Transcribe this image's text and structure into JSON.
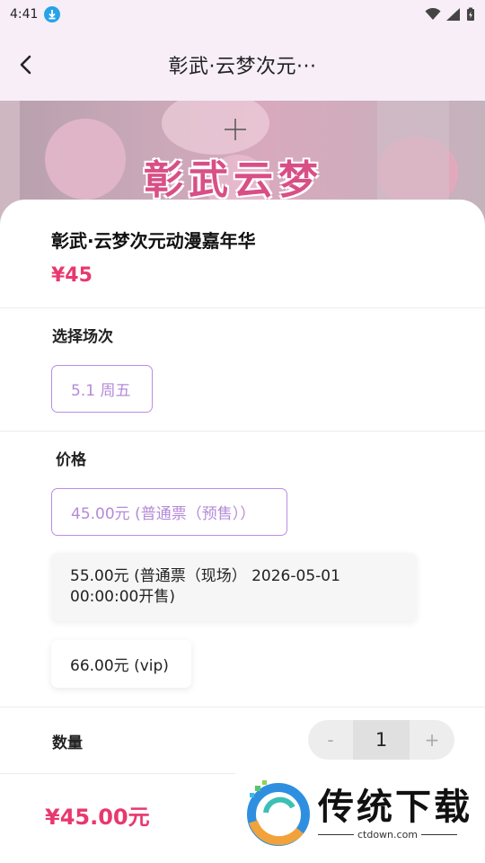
{
  "status": {
    "time": "4:41"
  },
  "header": {
    "title": "彰武·云梦次元···"
  },
  "banner": {
    "title": "彰武云梦"
  },
  "event": {
    "title": "彰武·云梦次元动漫嘉年华",
    "price": "¥45"
  },
  "session": {
    "label": "选择场次",
    "options": [
      "5.1 周五"
    ]
  },
  "pricing": {
    "label": "价格",
    "options": [
      "45.00元 (普通票（预售））",
      "55.00元 (普通票（现场） 2026-05-01",
      "00:00:00开售)",
      "66.00元 (vip)"
    ]
  },
  "quantity": {
    "label": "数量",
    "minus": "-",
    "value": "1",
    "plus": "+"
  },
  "footer": {
    "total": "¥45.00元"
  },
  "watermark": {
    "brand": "传统下载",
    "domain": "ctdown.com"
  },
  "colors": {
    "accent_pink": "#e8386e",
    "accent_purple": "#b98de6",
    "header_bg": "#f7eef8"
  }
}
